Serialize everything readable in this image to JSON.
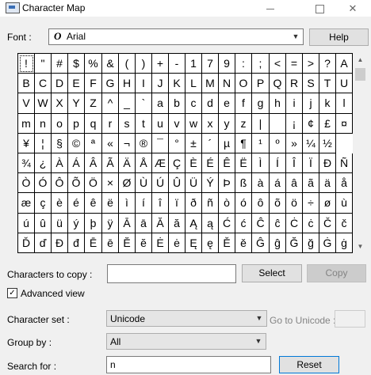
{
  "window": {
    "title": "Character Map"
  },
  "font": {
    "label": "Font :",
    "value": "Arial",
    "icon": "opentype-font-icon"
  },
  "buttons": {
    "help": "Help",
    "select": "Select",
    "copy": "Copy",
    "reset": "Reset"
  },
  "grid": {
    "rows": [
      [
        "!",
        "\"",
        "#",
        "$",
        "%",
        "&",
        "(",
        ")",
        "+",
        "-",
        "1",
        "7",
        "9",
        ":",
        ";",
        "<",
        "=",
        ">",
        "?",
        "A"
      ],
      [
        "B",
        "C",
        "D",
        "E",
        "F",
        "G",
        "H",
        "I",
        "J",
        "K",
        "L",
        "M",
        "N",
        "O",
        "P",
        "Q",
        "R",
        "S",
        "T",
        "U"
      ],
      [
        "V",
        "W",
        "X",
        "Y",
        "Z",
        "^",
        "_",
        "`",
        "a",
        "b",
        "c",
        "d",
        "e",
        "f",
        "g",
        "h",
        "i",
        "j",
        "k",
        "l"
      ],
      [
        "m",
        "n",
        "o",
        "p",
        "q",
        "r",
        "s",
        "t",
        "u",
        "v",
        "w",
        "x",
        "y",
        "z",
        "|",
        "",
        "¡",
        "¢",
        "£",
        "¤"
      ],
      [
        "¥",
        "¦",
        "§",
        "©",
        "ª",
        "«",
        "¬",
        "®",
        "¯",
        "°",
        "±",
        "´",
        "µ",
        "¶",
        "¹",
        "º",
        "»",
        "¼",
        "½"
      ],
      [
        "¾",
        "¿",
        "À",
        "Á",
        "Â",
        "Ã",
        "Ä",
        "Å",
        "Æ",
        "Ç",
        "È",
        "É",
        "Ê",
        "Ë",
        "Ì",
        "Í",
        "Î",
        "Ï",
        "Ð",
        "Ñ"
      ],
      [
        "Ò",
        "Ó",
        "Ô",
        "Õ",
        "Ö",
        "×",
        "Ø",
        "Ù",
        "Ú",
        "Û",
        "Ü",
        "Ý",
        "Þ",
        "ß",
        "à",
        "á",
        "â",
        "ã",
        "ä",
        "å"
      ],
      [
        "æ",
        "ç",
        "è",
        "é",
        "ê",
        "ë",
        "ì",
        "í",
        "î",
        "ï",
        "ð",
        "ñ",
        "ò",
        "ó",
        "ô",
        "õ",
        "ö",
        "÷",
        "ø",
        "ù"
      ],
      [
        "ú",
        "û",
        "ü",
        "ý",
        "þ",
        "ÿ",
        "Ā",
        "ā",
        "Ă",
        "ă",
        "Ą",
        "ą",
        "Ć",
        "ć",
        "Ĉ",
        "ĉ",
        "Ċ",
        "ċ",
        "Č",
        "č"
      ],
      [
        "Ď",
        "ď",
        "Đ",
        "đ",
        "Ē",
        "ē",
        "Ĕ",
        "ĕ",
        "Ė",
        "ė",
        "Ę",
        "ę",
        "Ě",
        "ě",
        "Ĝ",
        "ĝ",
        "Ğ",
        "ğ",
        "Ġ",
        "ġ"
      ]
    ],
    "selected": "!"
  },
  "chars_to_copy": {
    "label": "Characters to copy :",
    "value": ""
  },
  "advanced_view": {
    "label": "Advanced view",
    "checked": true
  },
  "character_set": {
    "label": "Character set :",
    "value": "Unicode"
  },
  "goto_unicode": {
    "label": "Go to Unicode :",
    "value": ""
  },
  "group_by": {
    "label": "Group by :",
    "value": "All"
  },
  "search": {
    "label": "Search for :",
    "value": "n"
  },
  "colors": {
    "focus": "#0078d7",
    "window": "#f0f0f0"
  }
}
